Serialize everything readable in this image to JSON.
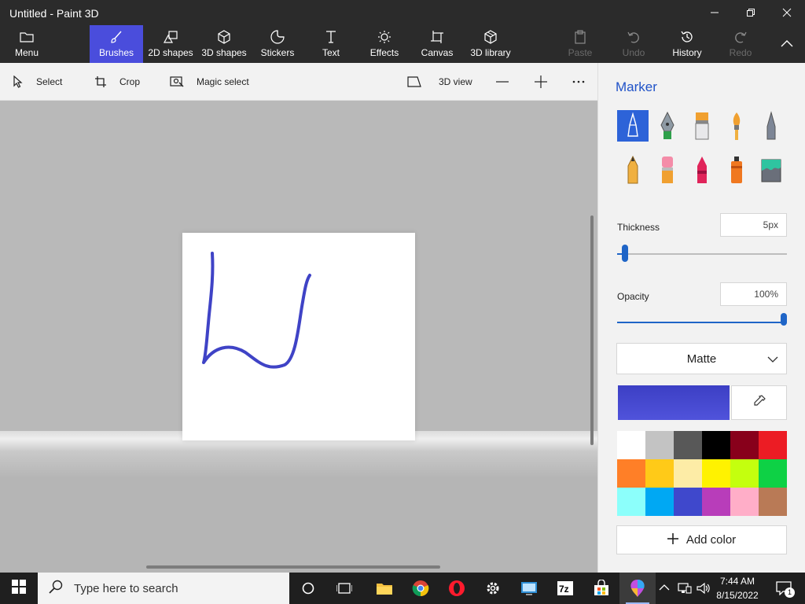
{
  "window": {
    "title": "Untitled - Paint 3D",
    "controls": [
      "minimize",
      "restore",
      "close"
    ]
  },
  "ribbon": {
    "tabs": [
      {
        "label": "Menu",
        "icon": "folder-icon",
        "state": "normal"
      },
      {
        "label": "Brushes",
        "icon": "brush-icon",
        "state": "active"
      },
      {
        "label": "2D shapes",
        "icon": "2d-shapes-icon",
        "state": "normal"
      },
      {
        "label": "3D shapes",
        "icon": "3d-shapes-icon",
        "state": "normal"
      },
      {
        "label": "Stickers",
        "icon": "stickers-icon",
        "state": "normal"
      },
      {
        "label": "Text",
        "icon": "text-icon",
        "state": "normal"
      },
      {
        "label": "Effects",
        "icon": "effects-icon",
        "state": "normal"
      },
      {
        "label": "Canvas",
        "icon": "canvas-icon",
        "state": "normal"
      },
      {
        "label": "3D library",
        "icon": "3d-library-icon",
        "state": "normal"
      },
      {
        "label": "Paste",
        "icon": "paste-icon",
        "state": "disabled"
      },
      {
        "label": "Undo",
        "icon": "undo-icon",
        "state": "disabled"
      },
      {
        "label": "History",
        "icon": "history-icon",
        "state": "normal"
      },
      {
        "label": "Redo",
        "icon": "redo-icon",
        "state": "disabled"
      }
    ],
    "collapse_icon": "chevron-up-icon",
    "active_color": "#4a4ddc"
  },
  "toolbar": {
    "select": "Select",
    "crop": "Crop",
    "magic_select": "Magic select",
    "view_3d": "3D view",
    "zoom_out_icon": "minus-icon",
    "zoom_in_icon": "plus-icon",
    "more_icon": "more-icon"
  },
  "canvas": {
    "stroke_color": "#3f43c6"
  },
  "panel": {
    "title": "Marker",
    "brushes": [
      {
        "name": "marker",
        "selected": true
      },
      {
        "name": "calligraphy-pen",
        "selected": false
      },
      {
        "name": "oil-brush",
        "selected": false
      },
      {
        "name": "watercolor",
        "selected": false
      },
      {
        "name": "pixel-pen",
        "selected": false
      },
      {
        "name": "pencil",
        "selected": false
      },
      {
        "name": "eraser",
        "selected": false
      },
      {
        "name": "crayon",
        "selected": false
      },
      {
        "name": "spray-can",
        "selected": false
      },
      {
        "name": "fill",
        "selected": false
      }
    ],
    "thickness": {
      "label": "Thickness",
      "value": "5px",
      "level": 0.03
    },
    "opacity": {
      "label": "Opacity",
      "value": "100%",
      "level": 1.0
    },
    "finish": {
      "selected": "Matte"
    },
    "current_color": "#4245cc",
    "eyedropper_icon": "eyedropper-icon",
    "palette": [
      "#ffffff",
      "#c3c3c3",
      "#585858",
      "#000000",
      "#88001b",
      "#ec1c24",
      "#ff7f27",
      "#ffca18",
      "#fdeca6",
      "#fff200",
      "#c4ff0e",
      "#0ed145",
      "#8cfffb",
      "#00a8f3",
      "#3f48cc",
      "#b83dba",
      "#ffaec8",
      "#b97a56"
    ],
    "add_color": "Add color"
  },
  "taskbar": {
    "search_placeholder": "Type here to search",
    "apps": [
      "cortana-icon",
      "task-view-icon",
      "file-explorer-icon",
      "chrome-icon",
      "opera-icon",
      "settings-icon",
      "control-panel-icon",
      "7zip-icon",
      "store-icon",
      "paint3d-icon"
    ],
    "time": "7:44 AM",
    "date": "8/15/2022",
    "notification_count": "1"
  }
}
